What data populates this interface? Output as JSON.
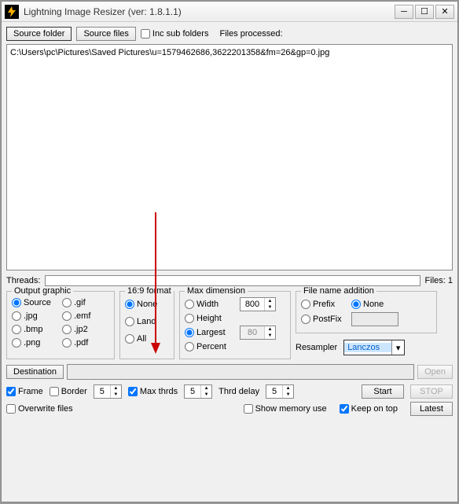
{
  "title": "Lightning Image Resizer (ver: 1.8.1.1)",
  "toolbar": {
    "source_folder": "Source folder",
    "source_files": "Source files",
    "inc_sub": "Inc sub folders",
    "files_processed": "Files processed:"
  },
  "filelist": {
    "items": [
      "C:\\Users\\pc\\Pictures\\Saved Pictures\\u=1579462686,3622201358&fm=26&gp=0.jpg"
    ]
  },
  "threads": {
    "label": "Threads:",
    "files": "Files: 1"
  },
  "output_graphic": {
    "legend": "Output graphic",
    "source": "Source",
    "gif": ".gif",
    "jpg": ".jpg",
    "emf": ".emf",
    "bmp": ".bmp",
    "jp2": ".jp2",
    "png": ".png",
    "pdf": ".pdf"
  },
  "format169": {
    "legend": "16:9 format",
    "none": "None",
    "land": "Land",
    "all": "All"
  },
  "maxdim": {
    "legend": "Max dimension",
    "width": "Width",
    "height": "Height",
    "largest": "Largest",
    "percent": "Percent",
    "v1": "800",
    "v2": "80"
  },
  "filename": {
    "legend": "File name addition",
    "prefix": "Prefix",
    "none": "None",
    "postfix": "PostFix",
    "resampler": "Resampler",
    "resampler_val": "Lanczos"
  },
  "dest": {
    "label": "Destination",
    "open": "Open"
  },
  "controls": {
    "frame": "Frame",
    "border": "Border",
    "maxthrds": "Max thrds",
    "thrddelay": "Thrd delay",
    "start": "Start",
    "stop": "STOP",
    "overwrite": "Overwrite files",
    "showmem": "Show memory use",
    "keepontop": "Keep on top",
    "latest": "Latest",
    "v_frame": "5",
    "v_max": "5",
    "v_delay": "5"
  }
}
